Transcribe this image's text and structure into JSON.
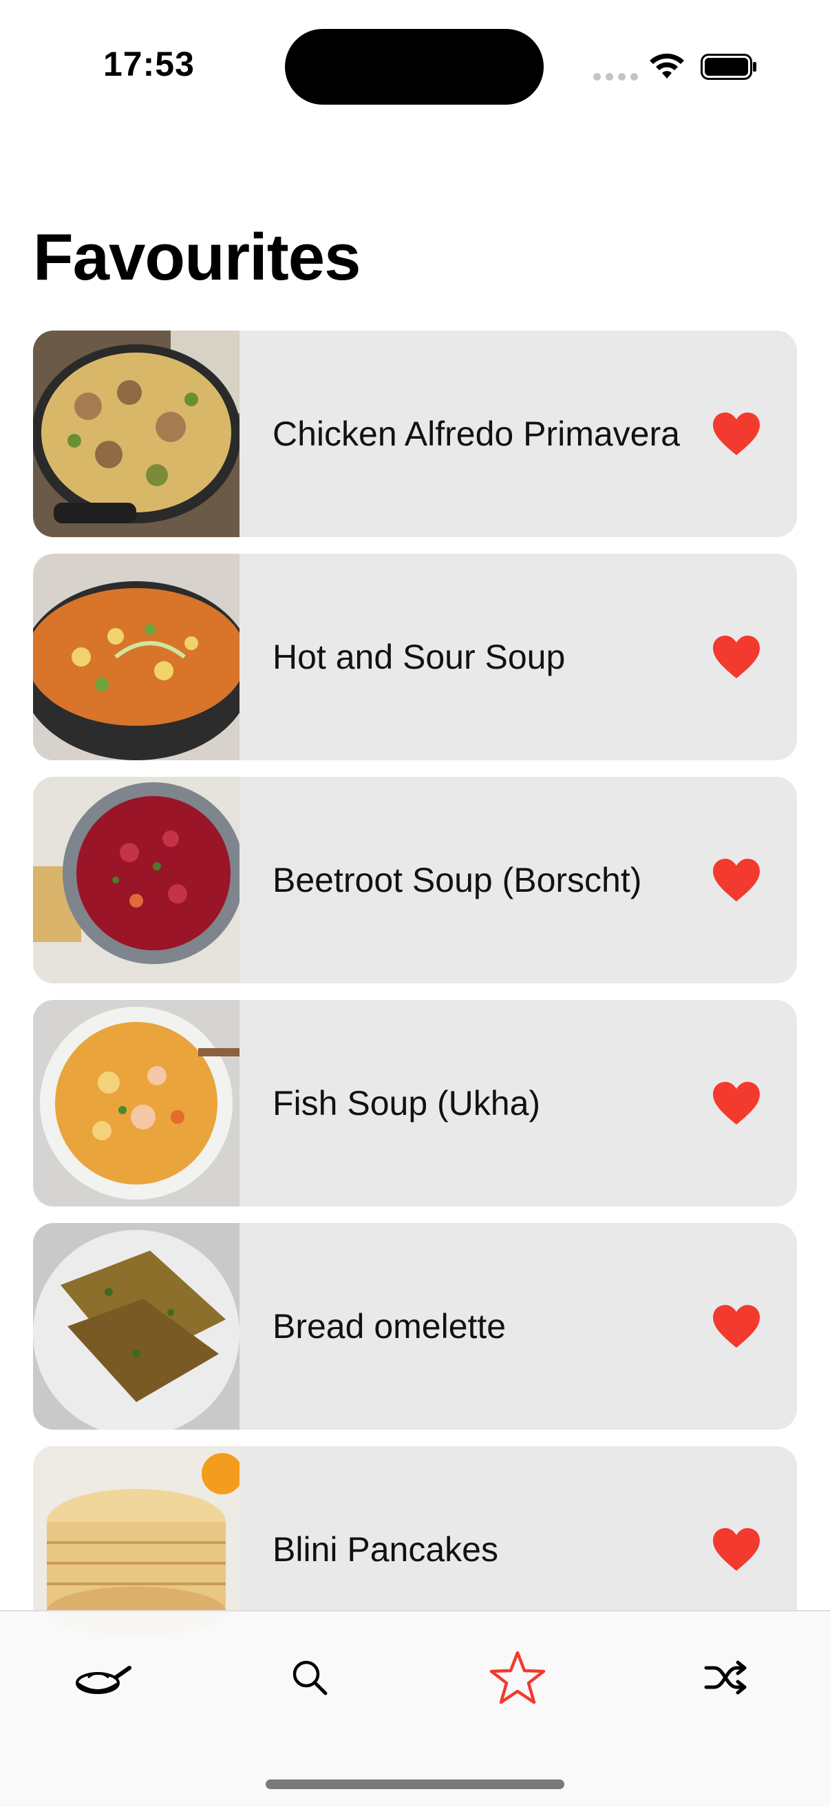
{
  "status_bar": {
    "time": "17:53"
  },
  "page": {
    "title": "Favourites"
  },
  "recipes": [
    {
      "name": "Chicken Alfredo Primavera",
      "favourite": true,
      "image": "pasta-skillet-image"
    },
    {
      "name": "Hot and Sour Soup",
      "favourite": true,
      "image": "soup-bowl-image"
    },
    {
      "name": "Beetroot Soup (Borscht)",
      "favourite": true,
      "image": "borscht-bowl-image"
    },
    {
      "name": "Fish Soup (Ukha)",
      "favourite": true,
      "image": "fish-soup-image"
    },
    {
      "name": "Bread omelette",
      "favourite": true,
      "image": "bread-omelette-image"
    },
    {
      "name": "Blini Pancakes",
      "favourite": true,
      "image": "pancake-stack-image"
    }
  ],
  "tab_bar": {
    "tabs": [
      {
        "icon": "pan-icon",
        "selected": false
      },
      {
        "icon": "search-icon",
        "selected": false
      },
      {
        "icon": "star-icon",
        "selected": true
      },
      {
        "icon": "shuffle-icon",
        "selected": false
      }
    ]
  },
  "colors": {
    "accent": "#f23a2f",
    "card_background": "#e9e9ea",
    "heart": "#f23a2f"
  }
}
